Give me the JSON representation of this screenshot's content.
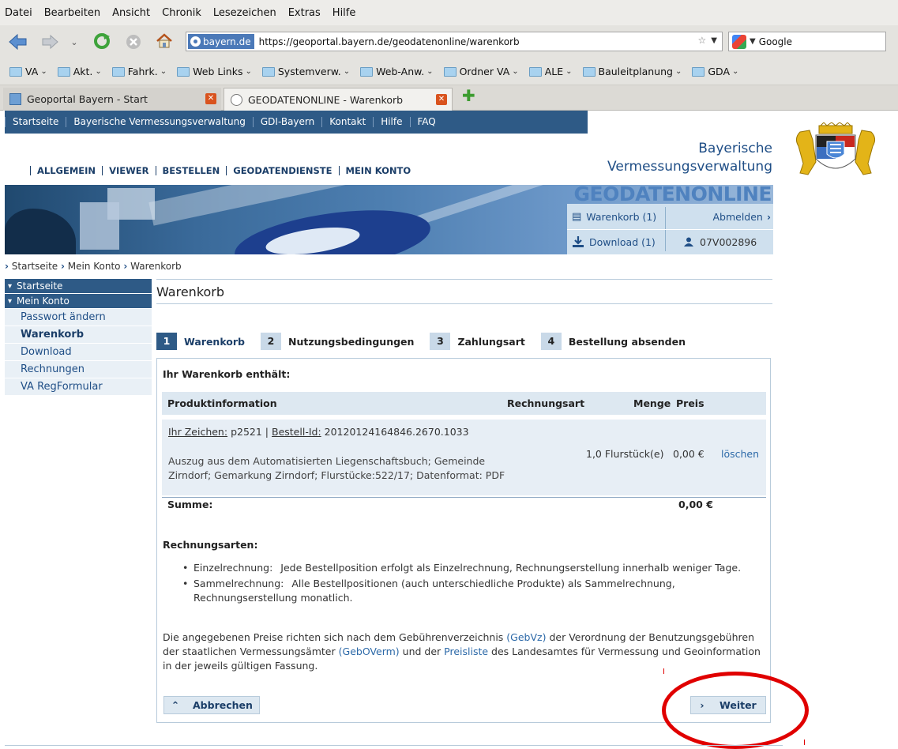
{
  "browser": {
    "menu": [
      "Datei",
      "Bearbeiten",
      "Ansicht",
      "Chronik",
      "Lesezeichen",
      "Extras",
      "Hilfe"
    ],
    "site_identity": "bayern.de",
    "url": "https://geoportal.bayern.de/geodatenonline/warenkorb",
    "search_engine": "Google",
    "bookmarks": [
      "VA",
      "Akt.",
      "Fahrk.",
      "Web Links",
      "Systemverw.",
      "Web-Anw.",
      "Ordner VA",
      "ALE",
      "Bauleitplanung",
      "GDA"
    ],
    "tabs": [
      {
        "title": "Geoportal Bayern - Start"
      },
      {
        "title": "GEODATENONLINE - Warenkorb"
      }
    ]
  },
  "top_nav": [
    "Startseite",
    "Bayerische Vermessungsverwaltung",
    "GDI-Bayern",
    "Kontakt",
    "Hilfe",
    "FAQ"
  ],
  "agency": {
    "line1": "Bayerische",
    "line2": "Vermessungsverwaltung"
  },
  "main_nav": [
    "ALLGEMEIN",
    "VIEWER",
    "BESTELLEN",
    "GEODATENDIENSTE",
    "MEIN KONTO"
  ],
  "banner_title": "GEODATENONLINE",
  "userbox": {
    "cart": "Warenkorb (1)",
    "logout": "Abmelden",
    "download": "Download (1)",
    "user_id": "07V002896"
  },
  "breadcrumb": [
    "Startseite",
    "Mein Konto",
    "Warenkorb"
  ],
  "sidebar": {
    "sections": [
      "Startseite",
      "Mein Konto"
    ],
    "items": [
      "Passwort ändern",
      "Warenkorb",
      "Download",
      "Rechnungen",
      "VA RegFormular"
    ]
  },
  "page_title": "Warenkorb",
  "steps": [
    {
      "num": "1",
      "label": "Warenkorb"
    },
    {
      "num": "2",
      "label": "Nutzungsbedingungen"
    },
    {
      "num": "3",
      "label": "Zahlungsart"
    },
    {
      "num": "4",
      "label": "Bestellung absenden"
    }
  ],
  "cart": {
    "contains_label": "Ihr Warenkorb enthält:",
    "headers": {
      "product": "Produktinformation",
      "billing": "Rechnungsart",
      "qty": "Menge",
      "price": "Preis"
    },
    "item": {
      "ref_label": "Ihr Zeichen:",
      "ref_value": "p2521",
      "order_label": "Bestell-Id:",
      "order_value": "20120124164846.2670.1033",
      "description": "Auszug aus dem Automatisierten Liegenschaftsbuch; Gemeinde Zirndorf; Gemarkung Zirndorf; Flurstücke:522/17; Datenformat: PDF",
      "quantity": "1,0 Flurstück(e)",
      "price": "0,00 €",
      "delete": "löschen"
    },
    "sum_label": "Summe:",
    "sum_value": "0,00 €"
  },
  "billing": {
    "title": "Rechnungsarten:",
    "types": [
      {
        "name": "Einzelrechnung:",
        "text": "Jede Bestellposition erfolgt als Einzelrechnung, Rechnungserstellung innerhalb weniger Tage."
      },
      {
        "name": "Sammelrechnung:",
        "text": "Alle Bestellpositionen (auch unterschiedliche Produkte) als Sammelrechnung, Rechnungserstellung monatlich."
      }
    ]
  },
  "note": {
    "part1": "Die angegebenen Preise richten sich nach dem Gebührenverzeichnis ",
    "link1": "(GebVz)",
    "part2": " der Verordnung der Benutzungsgebühren der staatlichen Vermessungsämter ",
    "link2": "(GebOVerm)",
    "part3": " und der ",
    "link3": "Preisliste",
    "part4": " des Landesamtes für Vermessung und Geoinformation in der jeweils gültigen Fassung."
  },
  "buttons": {
    "back": "Abbrechen",
    "next": "Weiter"
  },
  "colors": {
    "primary": "#2e5a86",
    "light": "#dde8f1",
    "link": "#2c69a8",
    "annotation": "#e00000"
  }
}
